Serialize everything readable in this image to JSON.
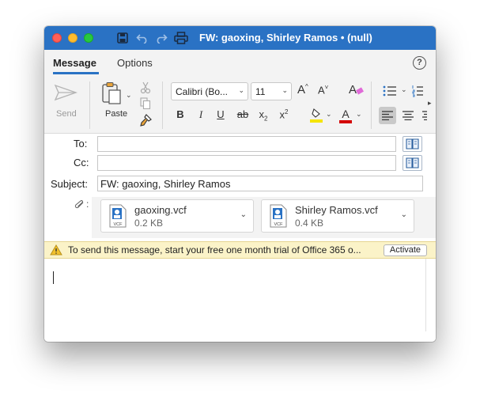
{
  "window": {
    "title": "FW: gaoxing, Shirley Ramos • (null)"
  },
  "tabs": [
    {
      "label": "Message",
      "active": true
    },
    {
      "label": "Options",
      "active": false
    }
  ],
  "ribbon": {
    "send_label": "Send",
    "paste_label": "Paste",
    "font_name": "Calibri (Bo...",
    "font_size": "11",
    "bold": "B",
    "italic": "I",
    "underline": "U",
    "strike": "ab",
    "subscript": "x",
    "subscript_mark": "2",
    "superscript": "x",
    "superscript_mark": "2",
    "grow_font": "A",
    "shrink_font": "A",
    "clear_format": "A",
    "font_color": "A",
    "highlight_color": "#f5e500",
    "font_color_value": "#d40000"
  },
  "fields": {
    "to_label": "To:",
    "to_value": "",
    "cc_label": "Cc:",
    "cc_value": "",
    "subject_label": "Subject:",
    "subject_value": "FW: gaoxing, Shirley Ramos"
  },
  "attachments": [
    {
      "name": "gaoxing.vcf",
      "size": "0.2 KB",
      "type": "VCF"
    },
    {
      "name": "Shirley Ramos.vcf",
      "size": "0.4 KB",
      "type": "VCF"
    }
  ],
  "notice": {
    "text": "To send this message, start your free one month trial of Office 365 o...",
    "button": "Activate"
  },
  "colors": {
    "titlebar": "#2a72c4",
    "accent": "#2a72c4",
    "notice_bg": "#fbf3c8"
  }
}
